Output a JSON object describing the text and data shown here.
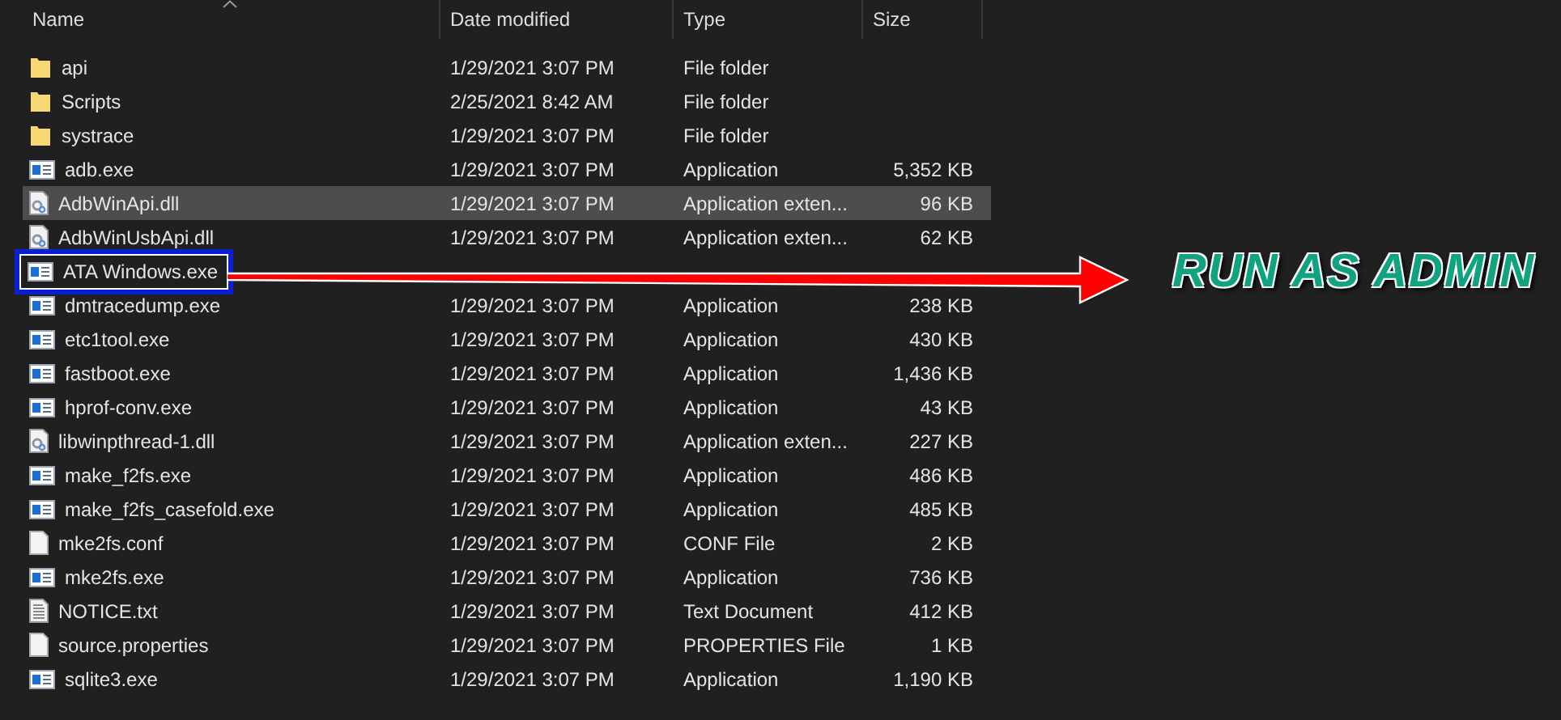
{
  "columns": [
    {
      "label": "Name",
      "sorted": true
    },
    {
      "label": "Date modified",
      "sorted": false
    },
    {
      "label": "Type",
      "sorted": false
    },
    {
      "label": "Size",
      "sorted": false
    }
  ],
  "rows": [
    {
      "kind": "folder",
      "name": "api",
      "date": "1/29/2021 3:07 PM",
      "type": "File folder",
      "selected": false,
      "outlined": false
    },
    {
      "kind": "folder",
      "name": "Scripts",
      "date": "2/25/2021 8:42 AM",
      "type": "File folder",
      "selected": false,
      "outlined": false
    },
    {
      "kind": "folder",
      "name": "systrace",
      "date": "1/29/2021 3:07 PM",
      "type": "File folder",
      "selected": false,
      "outlined": false
    },
    {
      "kind": "exe",
      "name": "adb.exe",
      "date": "1/29/2021 3:07 PM",
      "type": "Application",
      "size": "5,352 KB",
      "selected": false,
      "outlined": false
    },
    {
      "kind": "dll",
      "name": "AdbWinApi.dll",
      "date": "1/29/2021 3:07 PM",
      "type": "Application exten...",
      "size": "96 KB",
      "selected": true,
      "outlined": false
    },
    {
      "kind": "dll",
      "name": "AdbWinUsbApi.dll",
      "date": "1/29/2021 3:07 PM",
      "type": "Application exten...",
      "size": "62 KB",
      "selected": false,
      "outlined": false
    },
    {
      "kind": "exe",
      "name": "ATA Windows.exe",
      "selected": false,
      "outlined": true
    },
    {
      "kind": "exe",
      "name": "dmtracedump.exe",
      "date": "1/29/2021 3:07 PM",
      "type": "Application",
      "size": "238 KB",
      "selected": false,
      "outlined": false
    },
    {
      "kind": "exe",
      "name": "etc1tool.exe",
      "date": "1/29/2021 3:07 PM",
      "type": "Application",
      "size": "430 KB",
      "selected": false,
      "outlined": false
    },
    {
      "kind": "exe",
      "name": "fastboot.exe",
      "date": "1/29/2021 3:07 PM",
      "type": "Application",
      "size": "1,436 KB",
      "selected": false,
      "outlined": false
    },
    {
      "kind": "exe",
      "name": "hprof-conv.exe",
      "date": "1/29/2021 3:07 PM",
      "type": "Application",
      "size": "43 KB",
      "selected": false,
      "outlined": false
    },
    {
      "kind": "dll",
      "name": "libwinpthread-1.dll",
      "date": "1/29/2021 3:07 PM",
      "type": "Application exten...",
      "size": "227 KB",
      "selected": false,
      "outlined": false
    },
    {
      "kind": "exe",
      "name": "make_f2fs.exe",
      "date": "1/29/2021 3:07 PM",
      "type": "Application",
      "size": "486 KB",
      "selected": false,
      "outlined": false
    },
    {
      "kind": "exe",
      "name": "make_f2fs_casefold.exe",
      "date": "1/29/2021 3:07 PM",
      "type": "Application",
      "size": "485 KB",
      "selected": false,
      "outlined": false
    },
    {
      "kind": "file",
      "name": "mke2fs.conf",
      "date": "1/29/2021 3:07 PM",
      "type": "CONF File",
      "size": "2 KB",
      "selected": false,
      "outlined": false
    },
    {
      "kind": "exe",
      "name": "mke2fs.exe",
      "date": "1/29/2021 3:07 PM",
      "type": "Application",
      "size": "736 KB",
      "selected": false,
      "outlined": false
    },
    {
      "kind": "text",
      "name": "NOTICE.txt",
      "date": "1/29/2021 3:07 PM",
      "type": "Text Document",
      "size": "412 KB",
      "selected": false,
      "outlined": false
    },
    {
      "kind": "file",
      "name": "source.properties",
      "date": "1/29/2021 3:07 PM",
      "type": "PROPERTIES File",
      "size": "1 KB",
      "selected": false,
      "outlined": false
    },
    {
      "kind": "exe",
      "name": "sqlite3.exe",
      "date": "1/29/2021 3:07 PM",
      "type": "Application",
      "size": "1,190 KB",
      "selected": false,
      "outlined": false
    }
  ],
  "annotation": {
    "text": "RUN AS ADMIN"
  }
}
